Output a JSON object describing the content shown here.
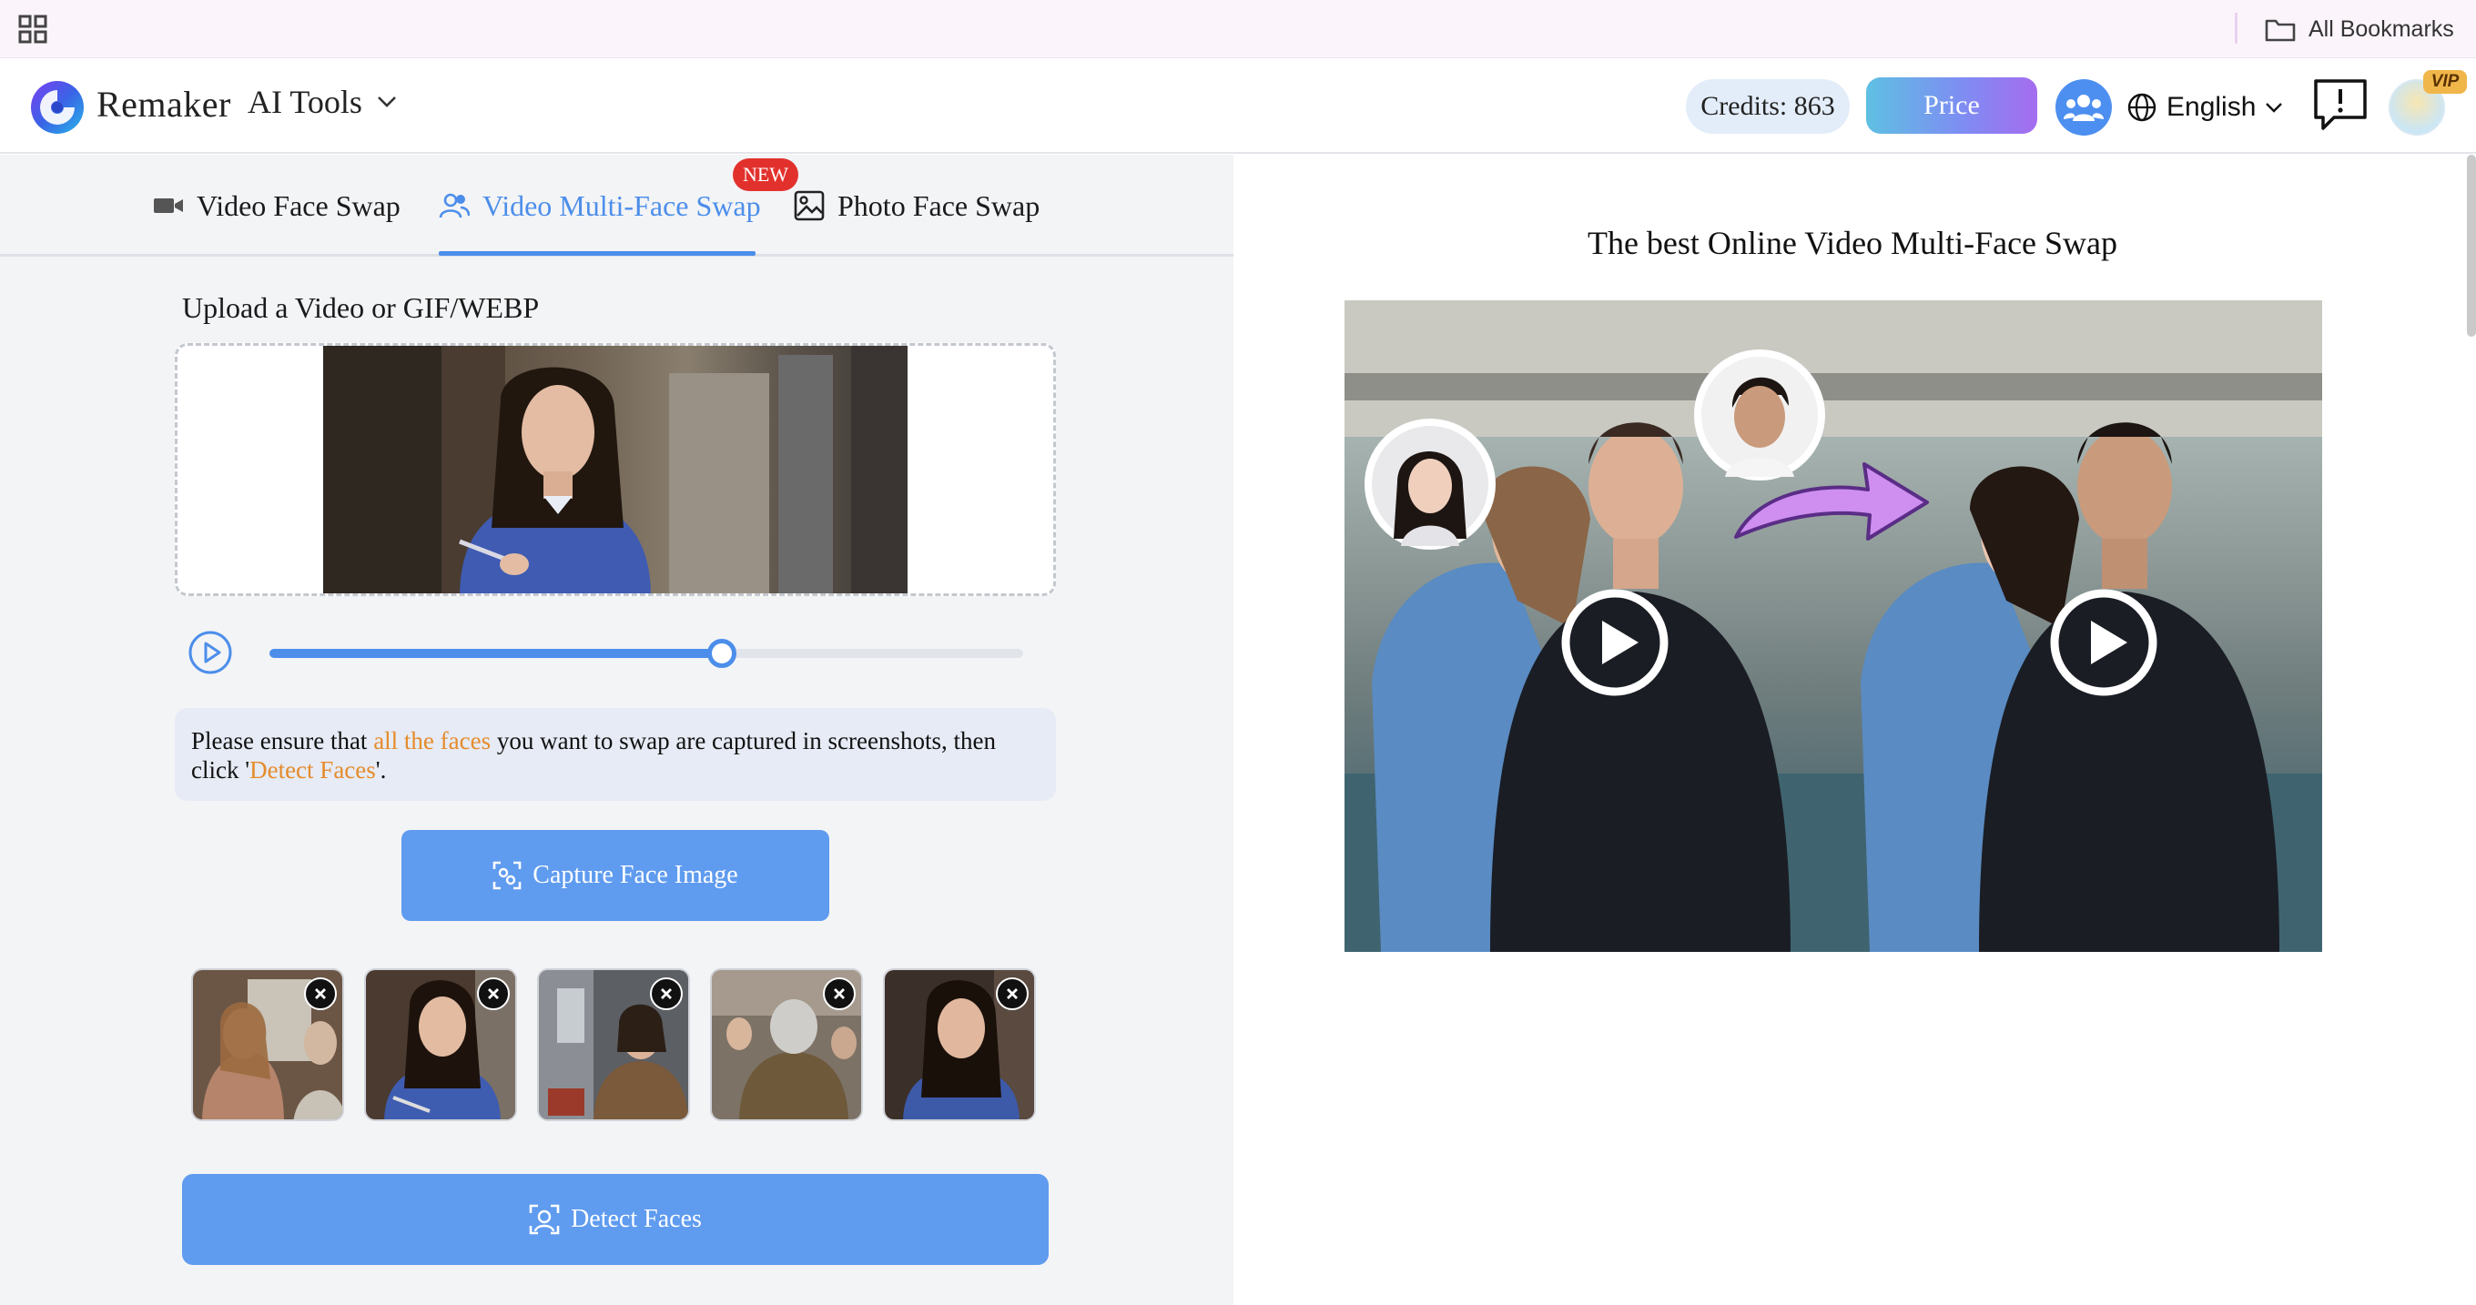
{
  "bookmarks_bar": {
    "apps_icon": "apps-grid-icon",
    "all_bookmarks_label": "All Bookmarks",
    "folder_icon": "folder-icon"
  },
  "header": {
    "brand": "Remaker",
    "ai_tools_label": "AI Tools",
    "credits_label": "Credits: 863",
    "price_label": "Price",
    "language_label": "English",
    "vip_label": "VIP",
    "accent_color": "#4c8eea"
  },
  "tabs": [
    {
      "label": "Video Face Swap",
      "icon": "video-camera-icon"
    },
    {
      "label": "Video Multi-Face Swap",
      "icon": "users-icon",
      "active": true
    },
    {
      "label": "Photo Face Swap",
      "icon": "image-icon"
    }
  ],
  "new_badge": "NEW",
  "upload": {
    "label": "Upload a Video or GIF/WEBP"
  },
  "player": {
    "progress": 0.6
  },
  "notice": {
    "part1": "Please ensure that ",
    "highlight1": "all the faces",
    "part2": " you want to swap are captured in screenshots, then click '",
    "highlight2": "Detect Faces",
    "part3": "'."
  },
  "capture_button_label": "Capture Face Image",
  "detect_button_label": "Detect Faces",
  "thumbnails_count": 5,
  "right": {
    "title": "The best Online Video Multi-Face Swap"
  }
}
